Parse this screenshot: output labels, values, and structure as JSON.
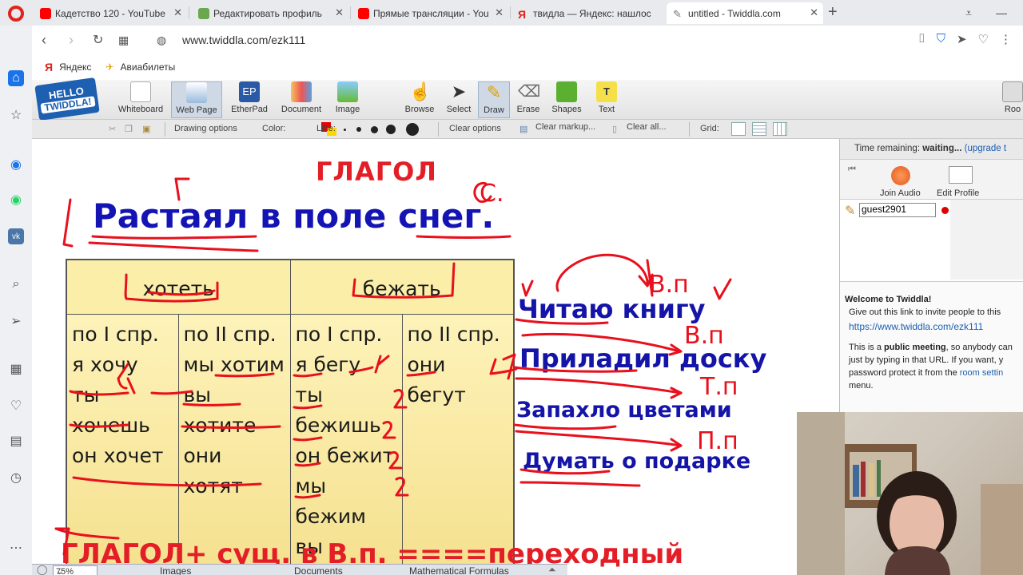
{
  "browser": {
    "tabs": [
      {
        "title": "Кадетство 120 - YouTube",
        "fav_color": "#ff0000"
      },
      {
        "title": "Редактировать профиль",
        "fav_color": "#6aa84f"
      },
      {
        "title": "Прямые трансляции - You",
        "fav_color": "#ff0000"
      },
      {
        "title": "твидла — Яндекс: нашлос",
        "fav_color": "#e0241b",
        "fav_letter": "Я"
      },
      {
        "title": "untitled - Twiddla.com",
        "fav_color": "#777777",
        "active": true
      }
    ],
    "url": "www.twiddla.com/ezk111",
    "bookmarks": [
      "Яндекс",
      "Авиабилеты"
    ],
    "bookmark_ya": "Я"
  },
  "twiddla": {
    "logo_top": "HELLO",
    "logo_name": "TWIDDLA!",
    "tools": [
      {
        "label": "Whiteboard"
      },
      {
        "label": "Web Page",
        "selected": true
      },
      {
        "label": "EtherPad",
        "icon_text": "EP"
      },
      {
        "label": "Document"
      },
      {
        "label": "Image"
      },
      {
        "label": "Browse"
      },
      {
        "label": "Select"
      },
      {
        "label": "Draw",
        "selected": true
      },
      {
        "label": "Erase"
      },
      {
        "label": "Shapes"
      },
      {
        "label": "Text",
        "icon_text": "T"
      },
      {
        "label": "Roo"
      }
    ],
    "sub": {
      "drawing_options": "Drawing options",
      "color": "Color:",
      "line": "Line:",
      "clear_options": "Clear options",
      "clear_markup": "Clear markup...",
      "clear_all": "Clear all...",
      "grid": "Grid:"
    }
  },
  "board": {
    "heading": "ГЛАГОЛ",
    "sentence_parts": [
      "Растаял",
      " в поле ",
      "снег",
      "."
    ],
    "ink_letters": {
      "g": "Г.",
      "s": "С."
    },
    "table": {
      "headers": [
        "хотеть",
        "бежать"
      ],
      "columns": [
        [
          "по I спр.",
          "я хочу",
          "ты хочешь",
          "он хочет"
        ],
        [
          "по II спр.",
          "мы хотим",
          "вы хотите",
          "они хотят"
        ],
        [
          "по I спр.",
          "я бегу",
          "ты бежишь",
          "он бежит",
          "мы бежим",
          "вы бежите"
        ],
        [
          "по II спр.",
          "они бегут"
        ]
      ]
    },
    "phrases": [
      {
        "parts": [
          "Читаю",
          " книгу"
        ],
        "case": "В.п"
      },
      {
        "parts": [
          "Приладил",
          " доску"
        ],
        "case": "В.п"
      },
      {
        "parts": [
          "Запахло",
          " цветами"
        ],
        "case": "Т.п"
      },
      {
        "parts": [
          "Думать",
          " о подарке"
        ],
        "case": "П.п"
      }
    ],
    "bottom": "ГЛАГОЛ+ сущ. в В.п. ====переходный",
    "colors": {
      "heading": "#e31e26",
      "sentence": "#1414b4",
      "ink": "#e8101c"
    }
  },
  "tray": {
    "zoom": "75%",
    "items": [
      "Images",
      "Documents",
      "Mathematical Formulas"
    ]
  },
  "panel": {
    "time_label": "Time remaining:",
    "time_value": "waiting...",
    "upgrade": "(upgrade t",
    "join_audio": "Join Audio",
    "edit_profile": "Edit Profile",
    "guest": "guest2901",
    "welcome_title": "Welcome to Twiddla!",
    "welcome_line1": "Give out this link to invite people to this",
    "invite_link": "https://www.twiddla.com/ezk111",
    "l2a": "This is a ",
    "l2b": "public meeting",
    "l2c": ", so anybody can",
    "l3": "just by typing in that URL. If you want, y",
    "l4a": "password protect it from the ",
    "l4b": "room settin",
    "l5": "menu."
  }
}
